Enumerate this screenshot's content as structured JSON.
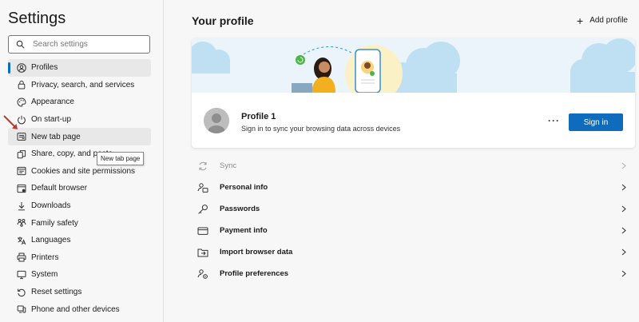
{
  "sidebar": {
    "title": "Settings",
    "search": {
      "placeholder": "Search settings",
      "icon": "search-icon"
    },
    "items": [
      {
        "label": "Profiles",
        "icon": "person-icon",
        "state": "active"
      },
      {
        "label": "Privacy, search, and services",
        "icon": "lock-icon"
      },
      {
        "label": "Appearance",
        "icon": "palette-icon"
      },
      {
        "label": "On start-up",
        "icon": "power-icon"
      },
      {
        "label": "New tab page",
        "icon": "newtab-icon",
        "state": "hover"
      },
      {
        "label": "Share, copy, and paste",
        "icon": "share-icon"
      },
      {
        "label": "Cookies and site permissions",
        "icon": "cookie-icon"
      },
      {
        "label": "Default browser",
        "icon": "browser-icon"
      },
      {
        "label": "Downloads",
        "icon": "download-icon"
      },
      {
        "label": "Family safety",
        "icon": "family-icon"
      },
      {
        "label": "Languages",
        "icon": "language-icon"
      },
      {
        "label": "Printers",
        "icon": "printer-icon"
      },
      {
        "label": "System",
        "icon": "system-icon"
      },
      {
        "label": "Reset settings",
        "icon": "reset-icon"
      },
      {
        "label": "Phone and other devices",
        "icon": "phone-icon"
      }
    ],
    "tooltip": "New tab page"
  },
  "main": {
    "title": "Your profile",
    "add_profile": {
      "label": "Add profile",
      "icon": "plus-icon"
    },
    "profile": {
      "name": "Profile 1",
      "subtitle": "Sign in to sync your browsing data across devices",
      "more_label": "···",
      "signin_label": "Sign in"
    },
    "rows": [
      {
        "label": "Sync",
        "icon": "sync-icon",
        "disabled": true
      },
      {
        "label": "Personal info",
        "icon": "personal-info-icon"
      },
      {
        "label": "Passwords",
        "icon": "key-icon"
      },
      {
        "label": "Payment info",
        "icon": "card-icon"
      },
      {
        "label": "Import browser data",
        "icon": "import-icon"
      },
      {
        "label": "Profile preferences",
        "icon": "preferences-icon"
      }
    ]
  },
  "colors": {
    "accent": "#0f6cbd",
    "sidebar_bg": "#f7f7f7",
    "banner_bg": "#eaf4fa",
    "annotation_arrow": "#c0392b"
  }
}
